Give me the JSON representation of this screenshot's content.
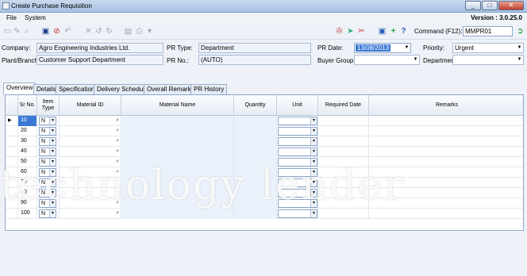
{
  "window": {
    "title": "Create Purchase Requisition",
    "min": "_",
    "max": "□",
    "close": "✕"
  },
  "menu": {
    "file": "File",
    "system": "System",
    "version": "Version : 3.0.25.0"
  },
  "toolbar": {
    "command_label": "Command (F12):",
    "command_value": "MMPR01"
  },
  "form": {
    "company_label": "Company:",
    "company_value": "Agro Engineering Industries Ltd.",
    "plant_label": "Plant/Branch:",
    "plant_value": "Customer Support Department",
    "pr_type_label": "PR Type:",
    "pr_type_value": "Department",
    "pr_no_label": "PR No.:",
    "pr_no_value": "(AUTO)",
    "pr_date_label": "PR Date:",
    "pr_date_value": "13/08/2013",
    "buyer_group_label": "Buyer Group:",
    "buyer_group_value": "",
    "priority_label": "Priority:",
    "priority_value": "Urgent",
    "department_label": "Department:",
    "department_value": ""
  },
  "tabs": [
    "Overview",
    "Details",
    "Specification",
    "Delivery Schedule",
    "Overall Remarks",
    "PR History"
  ],
  "grid": {
    "columns": [
      "Sr No.",
      "Item Type",
      "Material ID",
      "Material Name",
      "Quantity",
      "Unit",
      "Required Date",
      "Remarks"
    ],
    "rows": [
      {
        "sr": "10",
        "type": "N"
      },
      {
        "sr": "20",
        "type": "N"
      },
      {
        "sr": "30",
        "type": "N"
      },
      {
        "sr": "40",
        "type": "N"
      },
      {
        "sr": "50",
        "type": "N"
      },
      {
        "sr": "60",
        "type": "N"
      },
      {
        "sr": "70",
        "type": "N"
      },
      {
        "sr": "80",
        "type": "N"
      },
      {
        "sr": "90",
        "type": "N"
      },
      {
        "sr": "100",
        "type": "N"
      }
    ]
  },
  "watermark": "technology lender"
}
